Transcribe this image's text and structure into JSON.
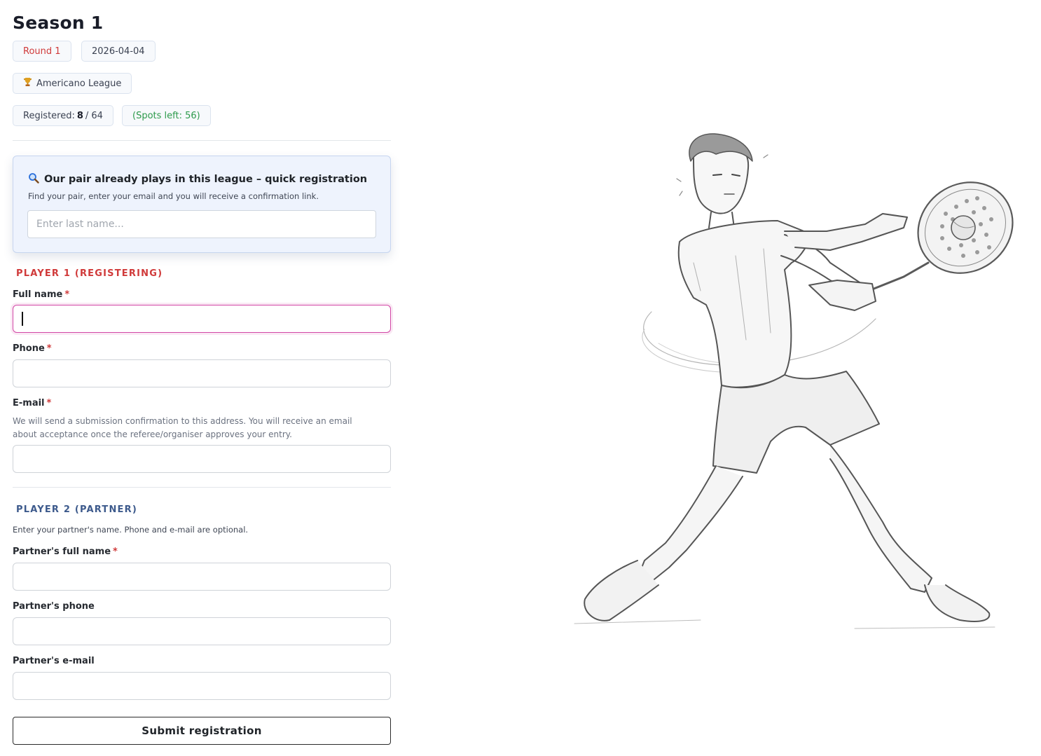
{
  "page": {
    "title": "Season 1"
  },
  "badges": {
    "round": "Round 1",
    "date": "2026-04-04",
    "league_icon": "trophy-icon",
    "league": "Americano League",
    "registered_label": "Registered:",
    "registered_count": "8",
    "registered_sep": "/",
    "registered_total": "64",
    "spots_left": "(Spots left: 56)"
  },
  "quick_registration": {
    "icon": "magnifier-icon",
    "title": "Our pair already plays in this league – quick registration",
    "subtitle": "Find your pair, enter your email and you will receive a confirmation link.",
    "search_placeholder": "Enter last name..."
  },
  "player1": {
    "heading": "PLAYER 1 (REGISTERING)",
    "full_name_label": "Full name",
    "phone_label": "Phone",
    "email_label": "E-mail",
    "required_mark": "*",
    "email_help": "We will send a submission confirmation to this address. You will receive an email about acceptance once the referee/organiser approves your entry."
  },
  "player2": {
    "heading": "PLAYER 2 (PARTNER)",
    "note": "Enter your partner's name. Phone and e-mail are optional.",
    "full_name_label": "Partner's full name",
    "required_mark": "*",
    "phone_label": "Partner's phone",
    "email_label": "Partner's e-mail"
  },
  "actions": {
    "submit_label": "Submit registration"
  },
  "illustration": {
    "subject": "pencil-sketch-padel-player-icon"
  },
  "colors": {
    "accent_red": "#d03a3a",
    "accent_green": "#2d9a4b",
    "accent_blue": "#3d5a8c",
    "focus_pink": "#d247a6"
  }
}
